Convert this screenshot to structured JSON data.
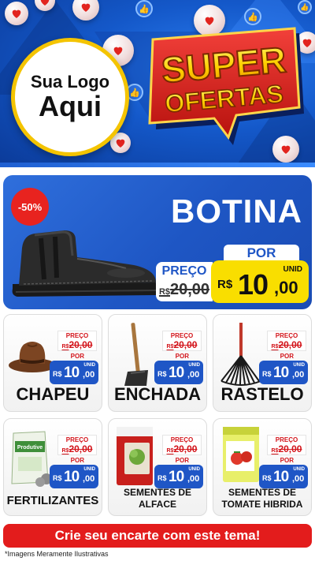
{
  "header": {
    "logo_line1": "Sua Logo",
    "logo_line2": "Aqui",
    "sign_line1": "SUPER",
    "sign_line2": "OFERTAS"
  },
  "hero": {
    "title": "BOTINA",
    "discount": "-50%",
    "old_label": "PREÇO",
    "old_currency": "R$",
    "old_value": "20,00",
    "por_label": "POR",
    "unit_label": "UNID",
    "currency": "R$",
    "price_int": "10",
    "price_dec": ",00"
  },
  "price_tag": {
    "old_label": "PREÇO",
    "old_currency": "R$",
    "old_value": "20,00",
    "por_label": "POR",
    "unit_label": "UNID",
    "currency": "R$",
    "price_int": "10",
    "price_dec": ",00"
  },
  "products": [
    {
      "name": "CHAPEU",
      "icon": "hat-icon"
    },
    {
      "name": "ENCHADA",
      "icon": "hoe-icon"
    },
    {
      "name": "RASTELO",
      "icon": "rake-icon"
    },
    {
      "name": "FERTILIZANTES",
      "icon": "fertilizer-bag-icon"
    },
    {
      "name_line1": "SEMENTES DE",
      "name_line2": "ALFACE",
      "icon": "lettuce-seed-packet-icon"
    },
    {
      "name_line1": "SEMENTES DE",
      "name_line2": "TOMATE HIBRIDA",
      "icon": "tomato-seed-packet-icon"
    }
  ],
  "cta": "Crie seu encarte com este tema!",
  "disclaimer": "*Imagens Meramente Ilustrativas",
  "colors": {
    "brand_blue": "#1f56c6",
    "accent_yellow": "#f9de00",
    "accent_red": "#e31c1c"
  }
}
